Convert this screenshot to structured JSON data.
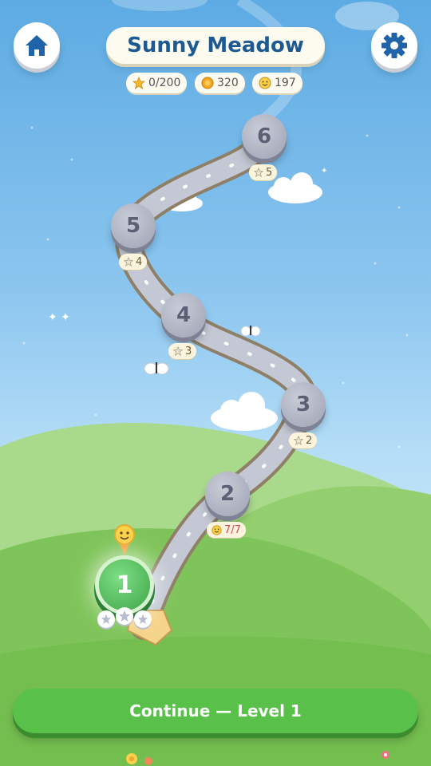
{
  "header": {
    "title": "Sunny Meadow",
    "home_icon": "home-icon",
    "settings_icon": "gear-icon"
  },
  "stats": {
    "stars": "0/200",
    "coins": "320",
    "smiles": "197"
  },
  "levels": [
    {
      "number": "1",
      "state": "current",
      "stars_earned": 0,
      "stars_total": 3
    },
    {
      "number": "2",
      "state": "locked",
      "requirement": "7/7",
      "requirement_icon": "smile-icon"
    },
    {
      "number": "3",
      "state": "locked",
      "requirement": "2",
      "requirement_icon": "star-icon"
    },
    {
      "number": "4",
      "state": "locked",
      "requirement": "3",
      "requirement_icon": "star-icon"
    },
    {
      "number": "5",
      "state": "locked",
      "requirement": "4",
      "requirement_icon": "star-icon"
    },
    {
      "number": "6",
      "state": "locked",
      "requirement": "5",
      "requirement_icon": "star-icon"
    }
  ],
  "continue_button": {
    "label": "Continue — Level 1"
  },
  "colors": {
    "sky": "#8cc6ef",
    "title_text": "#1e5a92",
    "current_level": "#4cb854",
    "locked_level": "#aeb2c1",
    "continue_button": "#59c04a",
    "requirement_met": "#d8475d"
  }
}
